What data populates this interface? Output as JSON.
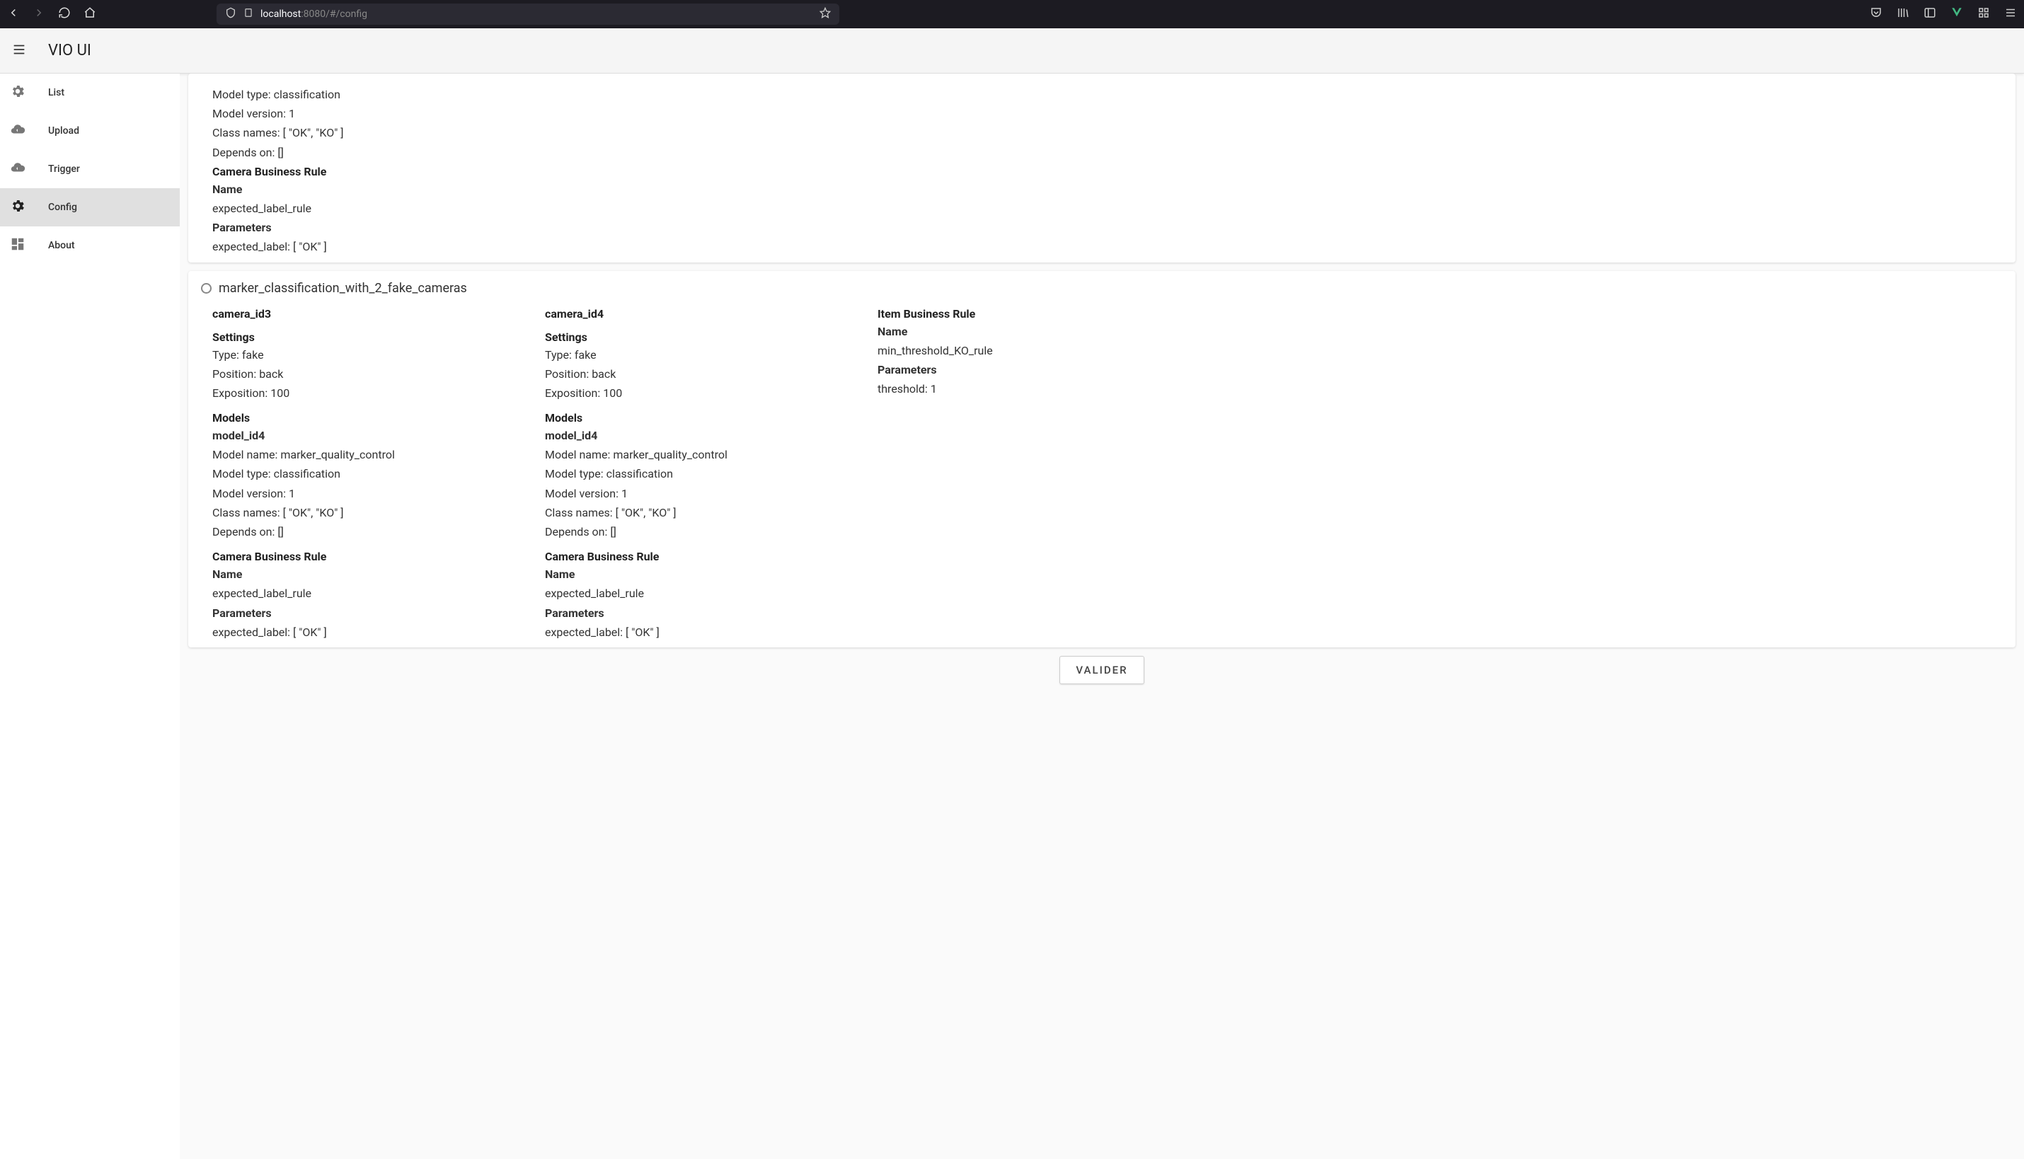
{
  "browser": {
    "url_host": "localhost",
    "url_port": ":8080",
    "url_path": "/#/config"
  },
  "app": {
    "title": "VIO UI"
  },
  "sidebar": {
    "items": [
      {
        "label": "List"
      },
      {
        "label": "Upload"
      },
      {
        "label": "Trigger"
      },
      {
        "label": "Config"
      },
      {
        "label": "About"
      }
    ]
  },
  "top_partial": {
    "model_type": "Model type: classification",
    "model_version": "Model version: 1",
    "class_names": "Class names: [ \"OK\", \"KO\" ]",
    "depends_on": "Depends on: []",
    "camera_rule_head": "Camera Business Rule",
    "name_head": "Name",
    "name_val": "expected_label_rule",
    "params_head": "Parameters",
    "params_val": "expected_label: [ \"OK\" ]"
  },
  "config2": {
    "title": "marker_classification_with_2_fake_cameras",
    "camA": {
      "id": "camera_id3",
      "settings_head": "Settings",
      "type": "Type: fake",
      "position": "Position: back",
      "exposition": "Exposition: 100",
      "models_head": "Models",
      "model_id": "model_id4",
      "model_name": "Model name: marker_quality_control",
      "model_type": "Model type: classification",
      "model_version": "Model version: 1",
      "class_names": "Class names: [ \"OK\", \"KO\" ]",
      "depends_on": "Depends on: []",
      "camera_rule_head": "Camera Business Rule",
      "name_head": "Name",
      "name_val": "expected_label_rule",
      "params_head": "Parameters",
      "params_val": "expected_label: [ \"OK\" ]"
    },
    "camB": {
      "id": "camera_id4",
      "settings_head": "Settings",
      "type": "Type: fake",
      "position": "Position: back",
      "exposition": "Exposition: 100",
      "models_head": "Models",
      "model_id": "model_id4",
      "model_name": "Model name: marker_quality_control",
      "model_type": "Model type: classification",
      "model_version": "Model version: 1",
      "class_names": "Class names: [ \"OK\", \"KO\" ]",
      "depends_on": "Depends on: []",
      "camera_rule_head": "Camera Business Rule",
      "name_head": "Name",
      "name_val": "expected_label_rule",
      "params_head": "Parameters",
      "params_val": "expected_label: [ \"OK\" ]"
    },
    "item_rule": {
      "head": "Item Business Rule",
      "name_head": "Name",
      "name_val": "min_threshold_KO_rule",
      "params_head": "Parameters",
      "params_val": "threshold: 1"
    }
  },
  "buttons": {
    "validate": "VALIDER"
  }
}
